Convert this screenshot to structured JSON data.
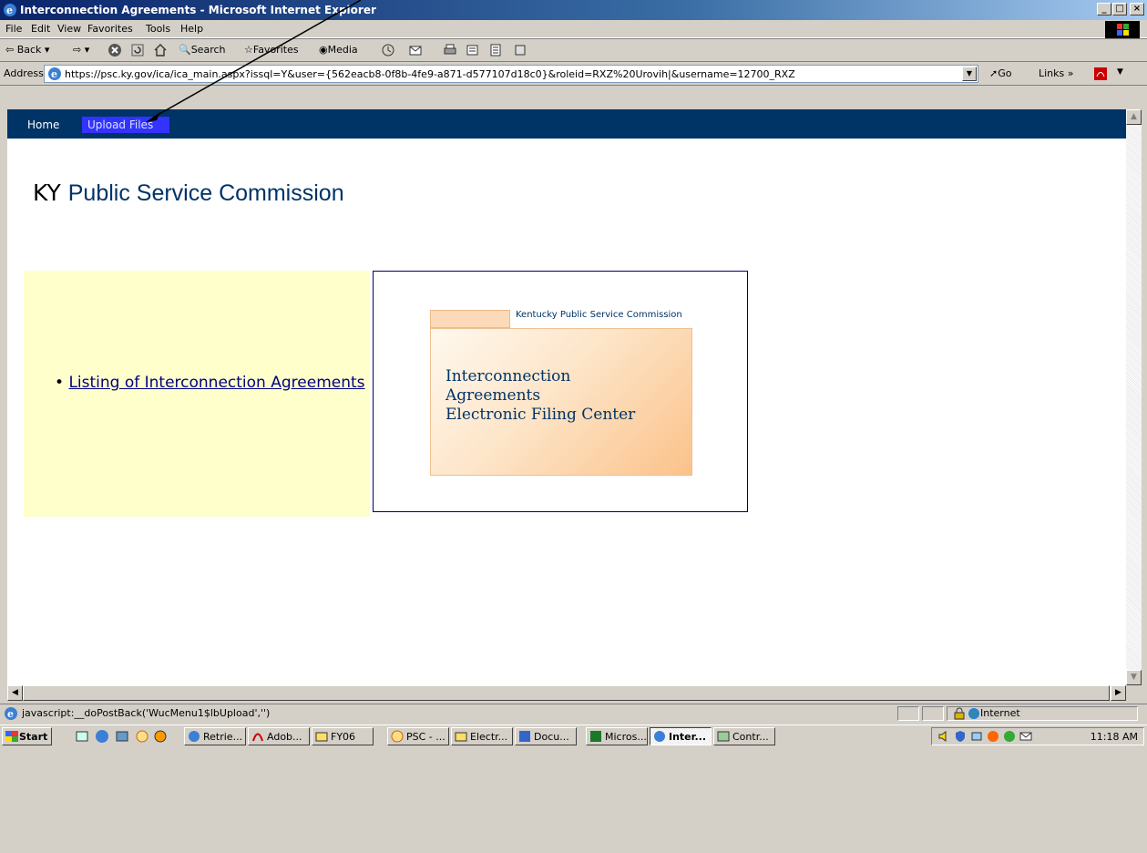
{
  "window": {
    "title": "Interconnection Agreements - Microsoft Internet Explorer",
    "min_label": "_",
    "max_label": "□",
    "close_label": "×"
  },
  "menu": [
    "File",
    "Edit",
    "View",
    "Favorites",
    "Tools",
    "Help"
  ],
  "toolbar": {
    "back": "Back",
    "search": "Search",
    "favorites": "Favorites",
    "media": "Media"
  },
  "address": {
    "label": "Address",
    "url": "https://psc.ky.gov/ica/ica_main.aspx?issql=Y&user={562eacb8-0f8b-4fe9-a871-d577107d18c0}&roleid=RXZ%20Urovih|&username=12700_RXZ",
    "go": "Go",
    "links": "Links"
  },
  "nav": {
    "home": "Home",
    "upload": "Upload Files"
  },
  "page": {
    "ky": "KY",
    "title": "Public Service Commission",
    "link": "Listing of Interconnection Agreements",
    "banner_header": "Kentucky Public Service Commission",
    "banner_line1": "Interconnection",
    "banner_line2": "Agreements",
    "banner_line3": "Electronic Filing Center"
  },
  "status": {
    "text": "javascript:__doPostBack('WucMenu1$lbUpload','')",
    "zone": "Internet"
  },
  "taskbar": {
    "start": "Start",
    "tasks": [
      "Retrie...",
      "Adob...",
      "FY06",
      "PSC - ...",
      "Electr...",
      "Docu...",
      "Micros...",
      "Inter...",
      "Contr..."
    ],
    "clock": "11:18 AM"
  },
  "colors": {
    "nav_bg": "#003366",
    "nav_active": "#3333ff",
    "panel_yellow": "#ffffcc",
    "heading_blue": "#003366"
  }
}
